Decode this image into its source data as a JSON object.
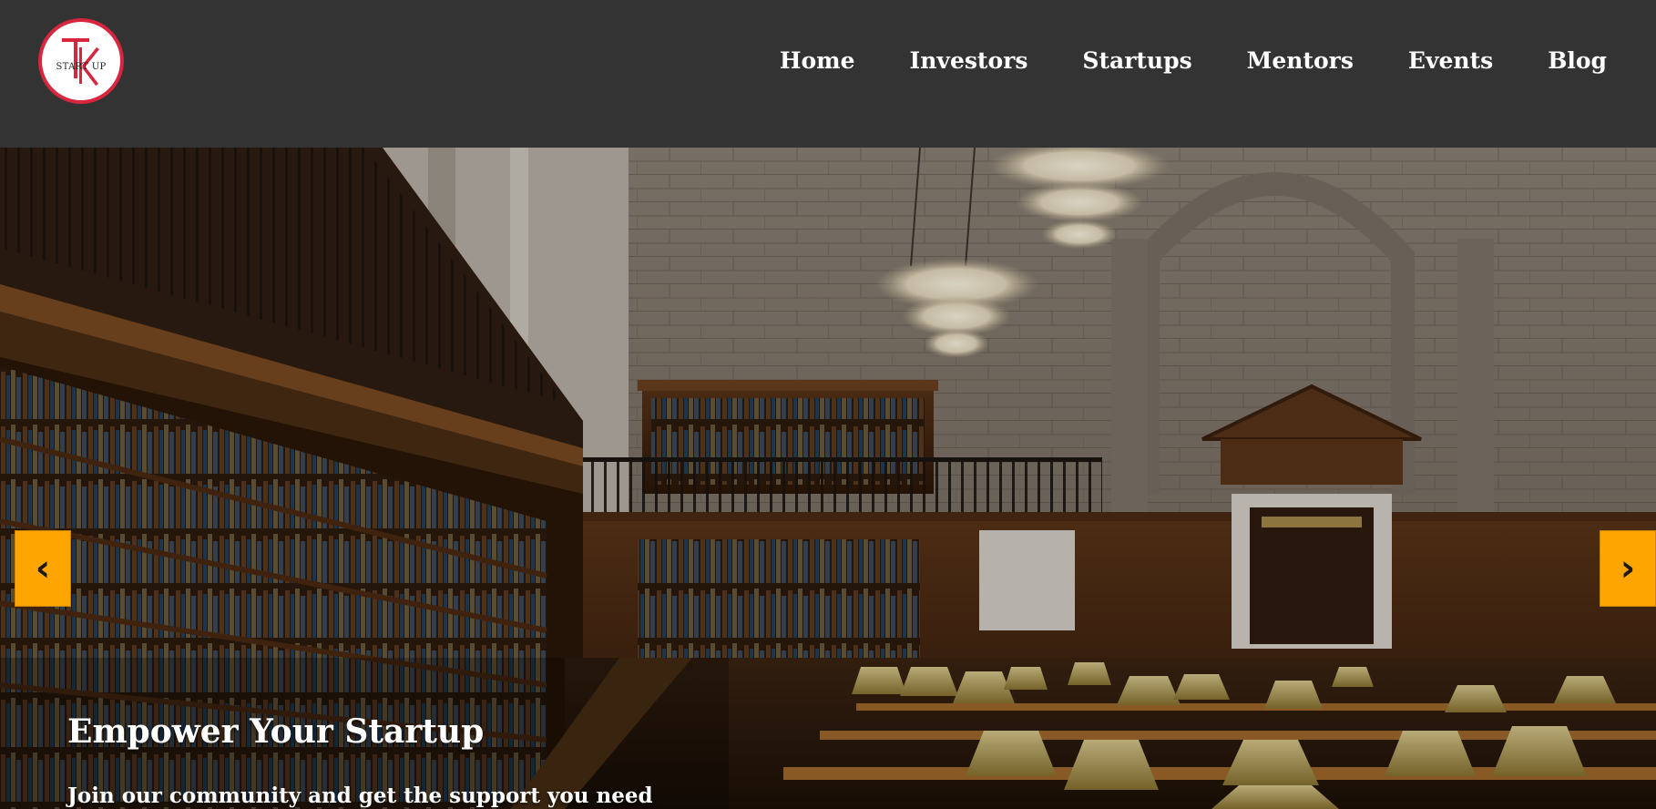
{
  "brand": {
    "logo_text": "START UP",
    "logo_letters": "TK",
    "accent": "#d7263d"
  },
  "nav": {
    "items": [
      {
        "label": "Home"
      },
      {
        "label": "Investors"
      },
      {
        "label": "Startups"
      },
      {
        "label": "Mentors"
      },
      {
        "label": "Events"
      },
      {
        "label": "Blog"
      }
    ]
  },
  "hero": {
    "title": "Empower Your Startup",
    "subtitle": "Join our community and get the support you need",
    "prev_icon": "‹",
    "next_icon": "›",
    "arrow_color": "#ffa500"
  }
}
